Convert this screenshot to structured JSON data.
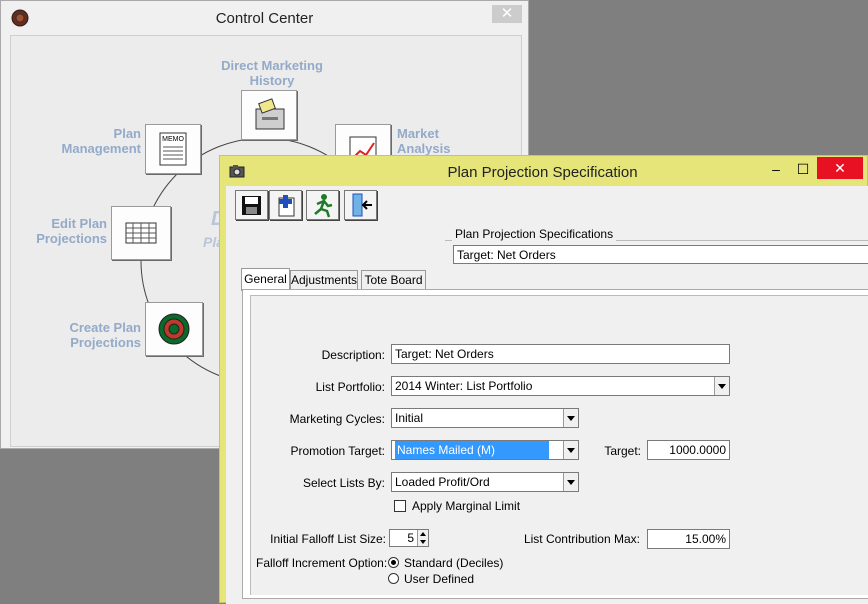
{
  "control_center": {
    "title": "Control Center",
    "close_glyph": "✕",
    "labels": {
      "direct_marketing_history": "Direct Marketing\nHistory",
      "market_analysis": "Market\nAnalysis",
      "plan_management": "Plan\nManagement",
      "edit_plan_projections": "Edit Plan\nProjections",
      "create_plan_projections": "Create Plan\nProjections"
    },
    "center_text_1": "D",
    "center_text_2": "Pla",
    "memo_text": "MEMO"
  },
  "plan_window": {
    "title": "Plan Projection Specification",
    "minimize_glyph": "–",
    "maximize_glyph": "☐",
    "close_glyph": "✕",
    "specs_group_label": "Plan Projection Specifications",
    "specs_value": "Target: Net Orders",
    "tabs": [
      "General",
      "Adjustments",
      "Tote Board"
    ],
    "form": {
      "description_label": "Description:",
      "description_value": "Target: Net Orders",
      "list_portfolio_label": "List Portfolio:",
      "list_portfolio_value": "2014 Winter:  List Portfolio",
      "marketing_cycles_label": "Marketing Cycles:",
      "marketing_cycles_value": "Initial",
      "promotion_target_label": "Promotion Target:",
      "promotion_target_value": "Names Mailed (M)",
      "target_label": "Target:",
      "target_value": "1000.0000",
      "select_lists_by_label": "Select Lists By:",
      "select_lists_by_value": "Loaded Profit/Ord",
      "apply_marginal_limit_label": "Apply Marginal Limit",
      "initial_falloff_label": "Initial Falloff List Size:",
      "initial_falloff_value": "5",
      "list_contribution_label": "List Contribution Max:",
      "list_contribution_value": "15.00%",
      "falloff_increment_label": "Falloff Increment Option:",
      "option_standard": "Standard (Deciles)",
      "option_user_defined": "User Defined"
    }
  },
  "colors": {
    "plan_titlebar": "#e6e57a",
    "close_red": "#e81123",
    "label_blue": "#93aac9",
    "selection_blue": "#3399ff"
  }
}
